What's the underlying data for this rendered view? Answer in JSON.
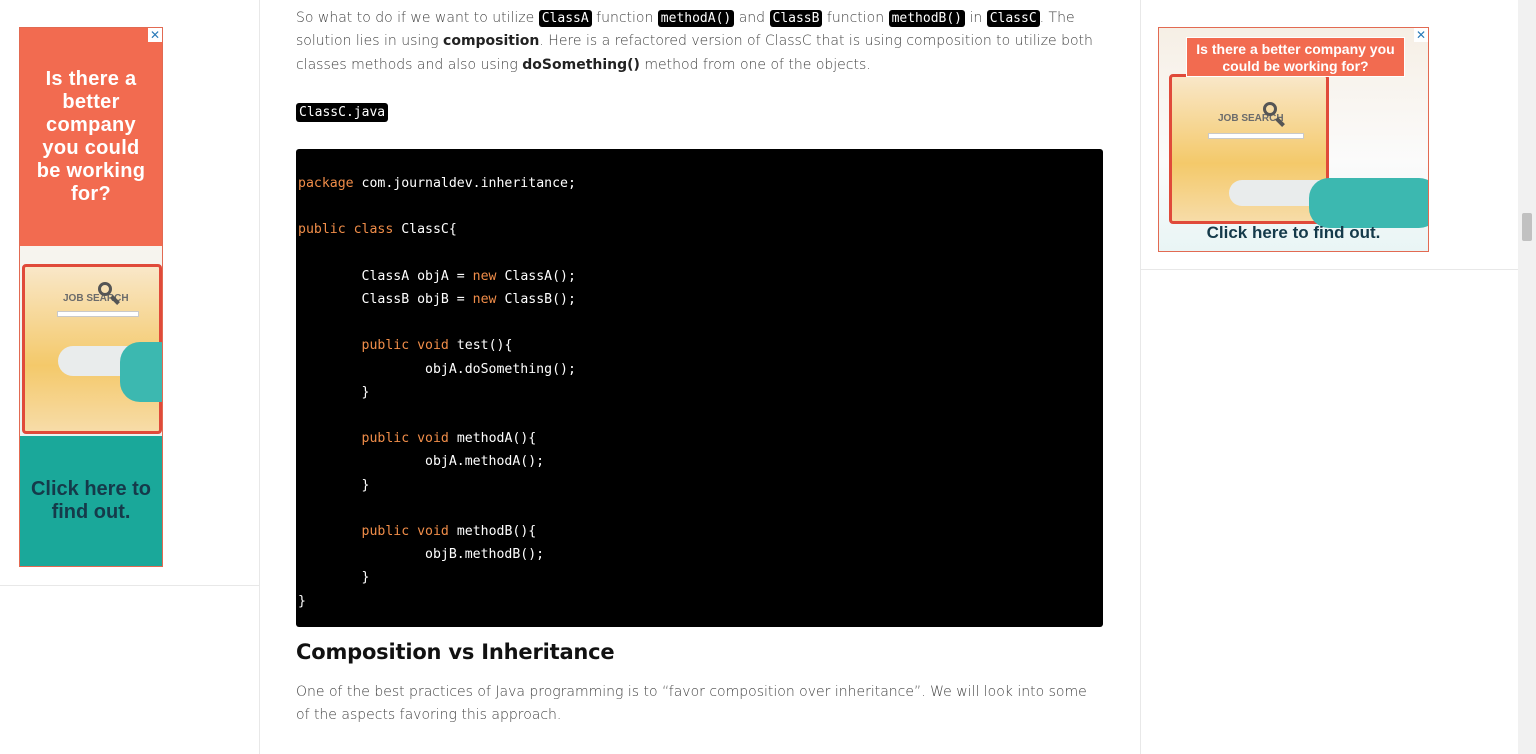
{
  "article": {
    "intro": {
      "t1": "So what to do if we want to utilize ",
      "c1": "ClassA",
      "t2": " function ",
      "c2": "methodA()",
      "t3": " and ",
      "c3": "ClassB",
      "t4": " function ",
      "c4": "methodB()",
      "t5": " in ",
      "c5": "ClassC",
      "t6": ". The solution lies in using ",
      "b1": "composition",
      "t7": ". Here is a refactored version of ClassC that is using composition to utilize both classes methods and also using ",
      "b2": "doSomething()",
      "t8": " method from one of the objects."
    },
    "filename": "ClassC.java",
    "code": {
      "l1_kw": "package",
      "l1_rest": " com.journaldev.inheritance;",
      "l2_kw": "public class",
      "l2_rest": " ClassC{",
      "l3_a": "        ClassA objA = ",
      "l3_kw": "new",
      "l3_b": " ClassA();",
      "l4_a": "        ClassB objB = ",
      "l4_kw": "new",
      "l4_b": " ClassB();",
      "l5_kw": "public void",
      "l5_rest": " test(){",
      "l6": "                objA.doSomething();",
      "l7": "        }",
      "l8_kw": "public void",
      "l8_rest": " methodA(){",
      "l9": "                objA.methodA();",
      "l10": "        }",
      "l11_kw": "public void",
      "l11_rest": " methodB(){",
      "l12": "                objB.methodB();",
      "l13": "        }",
      "l14": "}"
    },
    "heading": "Composition vs Inheritance",
    "para2": "One of the best practices of Java programming is to “favor composition over inheritance”. We will look into some of the aspects favoring this approach."
  },
  "ads": {
    "left": {
      "headline": "Is there a better company you could be working for?",
      "screen_label": "JOB SEARCH",
      "cta": "Click here to find out.",
      "close": "✕"
    },
    "right": {
      "headline": "Is there a better company you could be working for?",
      "screen_label": "JOB SEARCH",
      "cta": "Click here to find out.",
      "close": "✕"
    }
  },
  "colors": {
    "ad_orange": "#f26b50",
    "ad_teal": "#1aa89a",
    "code_keyword": "#f08d49",
    "code_bg": "#000000"
  }
}
